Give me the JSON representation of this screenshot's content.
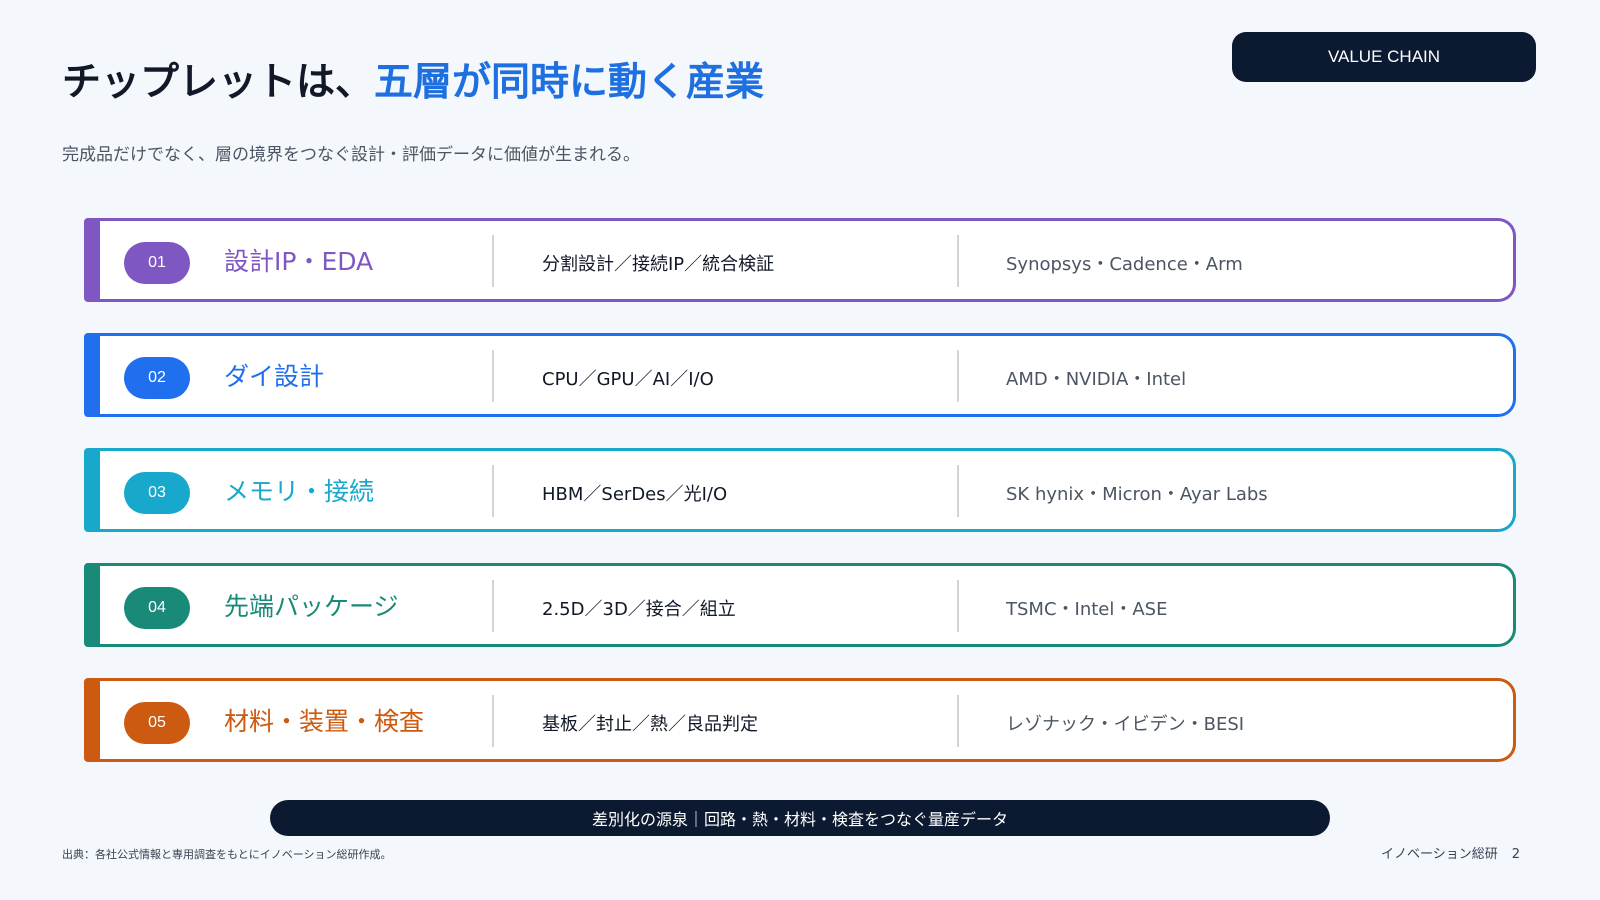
{
  "badge": "VALUE CHAIN",
  "title": {
    "lead": "チップレットは、",
    "accent": "五層が同時に動く産業"
  },
  "subtitle": "完成品だけでなく、層の境界をつなぐ設計・評価データに価値が生まれる。",
  "colors": {
    "purple": "#7e57c2",
    "blue": "#1f6fef",
    "cyan": "#18a8cc",
    "teal": "#1a8a78",
    "orange": "#cc5a10",
    "navy": "#0b1a30",
    "accent": "#1e6fe0"
  },
  "layers": [
    {
      "num": "01",
      "name": "設計IP・EDA",
      "tech": "分割設計／接続IP／統合検証",
      "players": "Synopsys・Cadence・Arm",
      "color": "#7e57c2"
    },
    {
      "num": "02",
      "name": "ダイ設計",
      "tech": "CPU／GPU／AI／I/O",
      "players": "AMD・NVIDIA・Intel",
      "color": "#1f6fef"
    },
    {
      "num": "03",
      "name": "メモリ・接続",
      "tech": "HBM／SerDes／光I/O",
      "players": "SK hynix・Micron・Ayar Labs",
      "color": "#18a8cc"
    },
    {
      "num": "04",
      "name": "先端パッケージ",
      "tech": "2.5D／3D／接合／組立",
      "players": "TSMC・Intel・ASE",
      "color": "#1a8a78"
    },
    {
      "num": "05",
      "name": "材料・装置・検査",
      "tech": "基板／封止／熱／良品判定",
      "players": "レゾナック・イビデン・BESI",
      "color": "#cc5a10"
    }
  ],
  "banner": "差別化の源泉｜回路・熱・材料・検査をつなぐ量産データ",
  "source": "出典：各社公式情報と専用調査をもとにイノベーション総研作成。",
  "footer": {
    "org": "イノベーション総研",
    "page": "2"
  }
}
